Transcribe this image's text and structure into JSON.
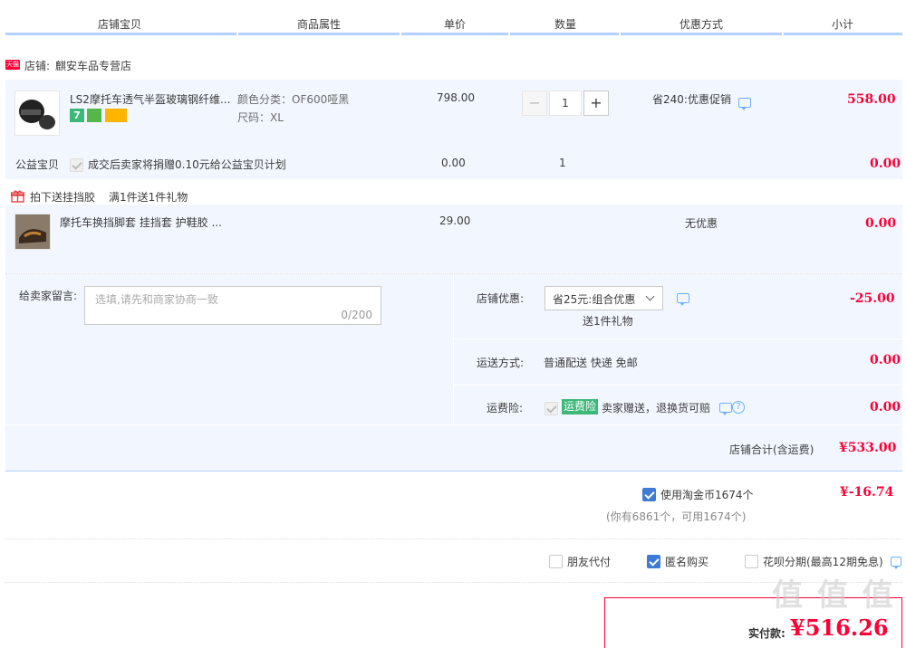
{
  "header": {
    "cols": [
      "店铺宝贝",
      "商品属性",
      "单价",
      "数量",
      "优惠方式",
      "小计"
    ]
  },
  "shop": {
    "badge": "天猫",
    "label": "店铺:",
    "name": "麒安车品专营店"
  },
  "item1": {
    "title": "LS2摩托车透气半盔玻璃钢纤维...",
    "attr_color": "颜色分类：OF600哑黑",
    "attr_size": "尺码：XL",
    "price": "798.00",
    "qty": "1",
    "discount": "省240:优惠促销",
    "subtotal": "558.00",
    "minus": "−",
    "plus": "+"
  },
  "charity": {
    "label": "公益宝贝",
    "text": "成交后卖家将捐赠0.10元给公益宝贝计划",
    "price": "0.00",
    "qty": "1",
    "subtotal": "0.00"
  },
  "gift": {
    "title": "拍下送挂挡胶",
    "desc": "满1件送1件礼物",
    "item_title": "摩托车换挡脚套 挂挡套 护鞋胶 ...",
    "price": "29.00",
    "discount": "无优惠",
    "subtotal": "0.00"
  },
  "message": {
    "label": "给卖家留言:",
    "placeholder": "选填,请先和商家协商一致",
    "counter": "0/200"
  },
  "shop_discount": {
    "label": "店铺优惠:",
    "selected": "省25元:组合优惠",
    "sub": "送1件礼物",
    "value": "-25.00"
  },
  "shipping": {
    "label": "运送方式:",
    "value": "普通配送 快递 免邮",
    "price": "0.00"
  },
  "insurance": {
    "label": "运费险:",
    "tag": "运费险",
    "text": "卖家赠送，退换货可赔",
    "price": "0.00"
  },
  "shop_total": {
    "label": "店铺合计(含运费)",
    "value": "¥533.00"
  },
  "coins": {
    "label": "使用淘金币1674个",
    "sub": "(你有6861个，可用1674个)",
    "value": "¥-16.74"
  },
  "options": {
    "friend_pay": "朋友代付",
    "anonymous": "匿名购买",
    "huabei": "花呗分期(最高12期免息)"
  },
  "final": {
    "label": "实付款:",
    "value": "¥516.26"
  },
  "watermark": "值 值 值"
}
